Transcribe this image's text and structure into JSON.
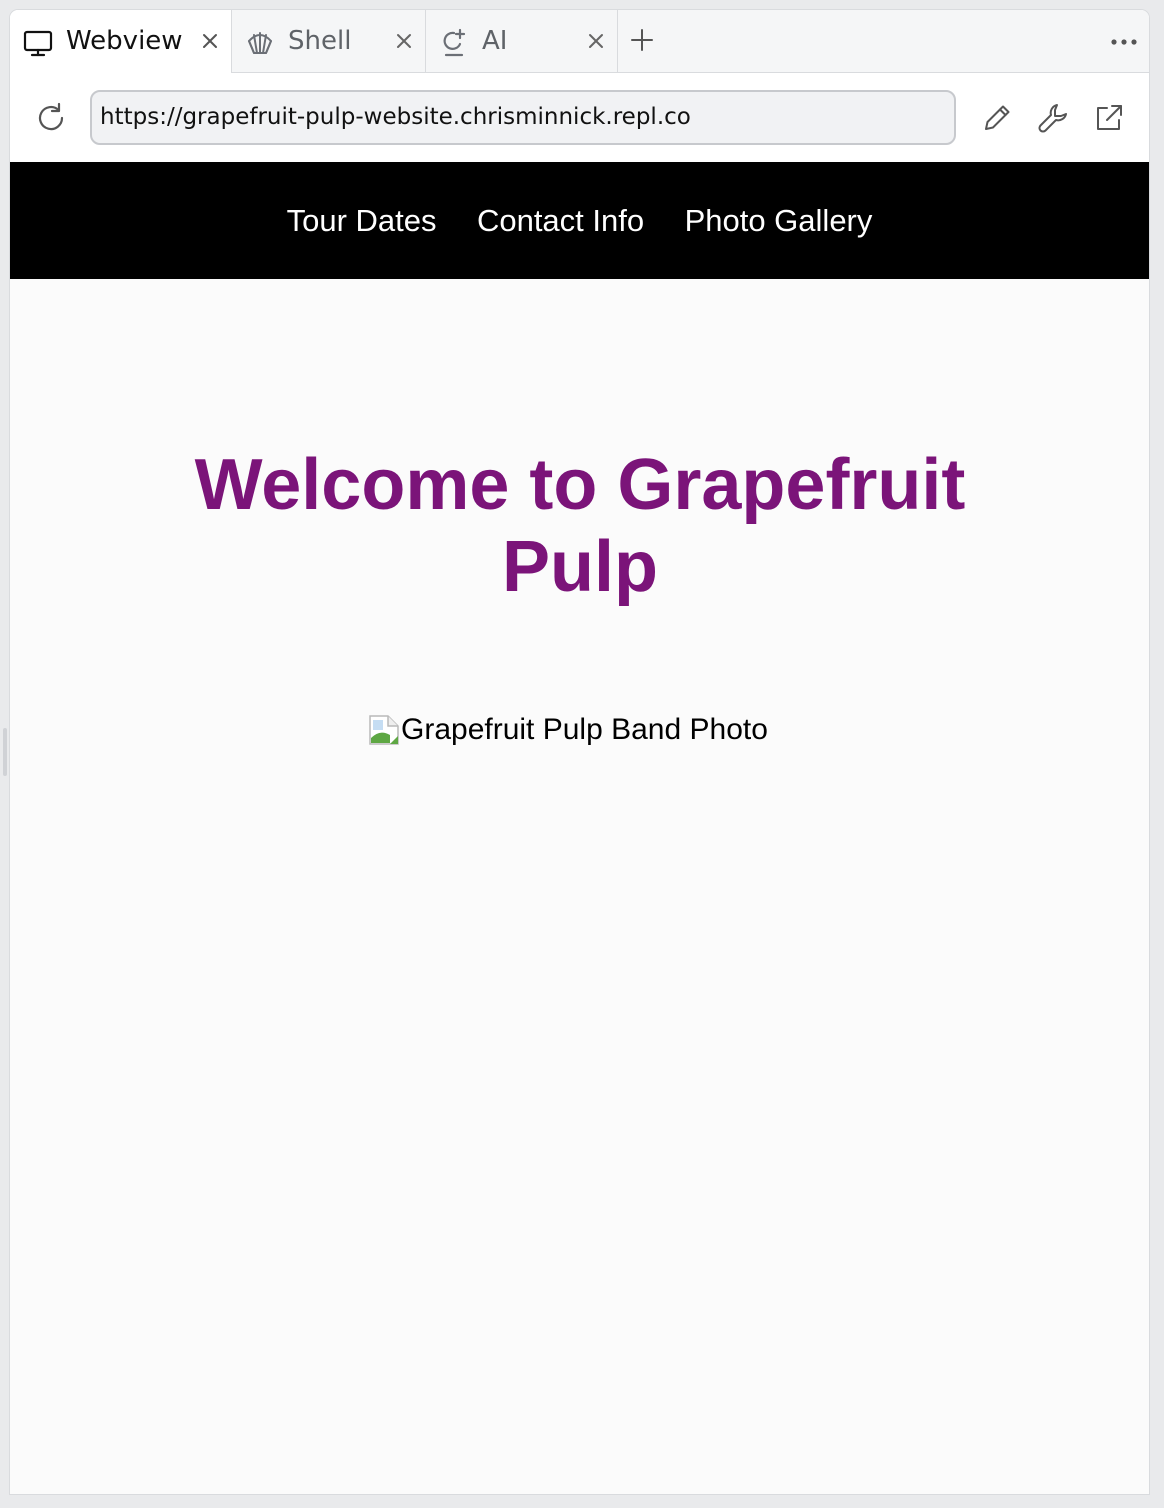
{
  "tabs": [
    {
      "label": "Webview",
      "icon": "monitor-icon",
      "active": true
    },
    {
      "label": "Shell",
      "icon": "shell-icon",
      "active": false
    },
    {
      "label": "AI",
      "icon": "ai-icon",
      "active": false
    }
  ],
  "toolbar": {
    "url": "https://grapefruit-pulp-website.chrisminnick.repl.co",
    "icons": [
      "reload-icon",
      "pencil-icon",
      "wrench-icon",
      "open-external-icon"
    ]
  },
  "site": {
    "nav": [
      "Tour Dates",
      "Contact Info",
      "Photo Gallery"
    ],
    "heading": "Welcome to Grapefruit Pulp",
    "image_alt": "Grapefruit Pulp Band Photo"
  },
  "colors": {
    "heading": "#7b1479",
    "nav_background": "#000000",
    "nav_text": "#ffffff",
    "page_background": "#fbfbfb"
  }
}
